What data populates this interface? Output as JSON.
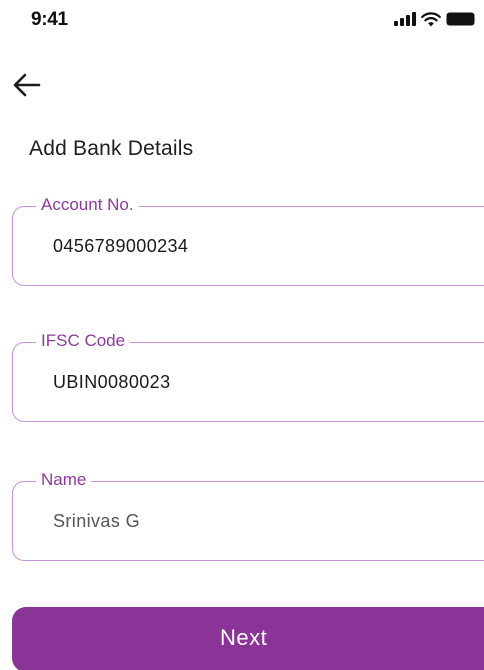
{
  "status_bar": {
    "time": "9:41"
  },
  "header": {
    "back_icon": "arrow-left-icon",
    "title": "Add Bank Details"
  },
  "form": {
    "account_number": {
      "label": "Account No.",
      "value": "0456789000234"
    },
    "ifsc_code": {
      "label": "IFSC Code",
      "value": "UBIN0080023"
    },
    "name": {
      "label": "Name",
      "value": "Srinivas G"
    }
  },
  "actions": {
    "next_label": "Next"
  },
  "colors": {
    "accent": "#893496",
    "field_border": "#c792d9",
    "label": "#8e3a9e"
  }
}
